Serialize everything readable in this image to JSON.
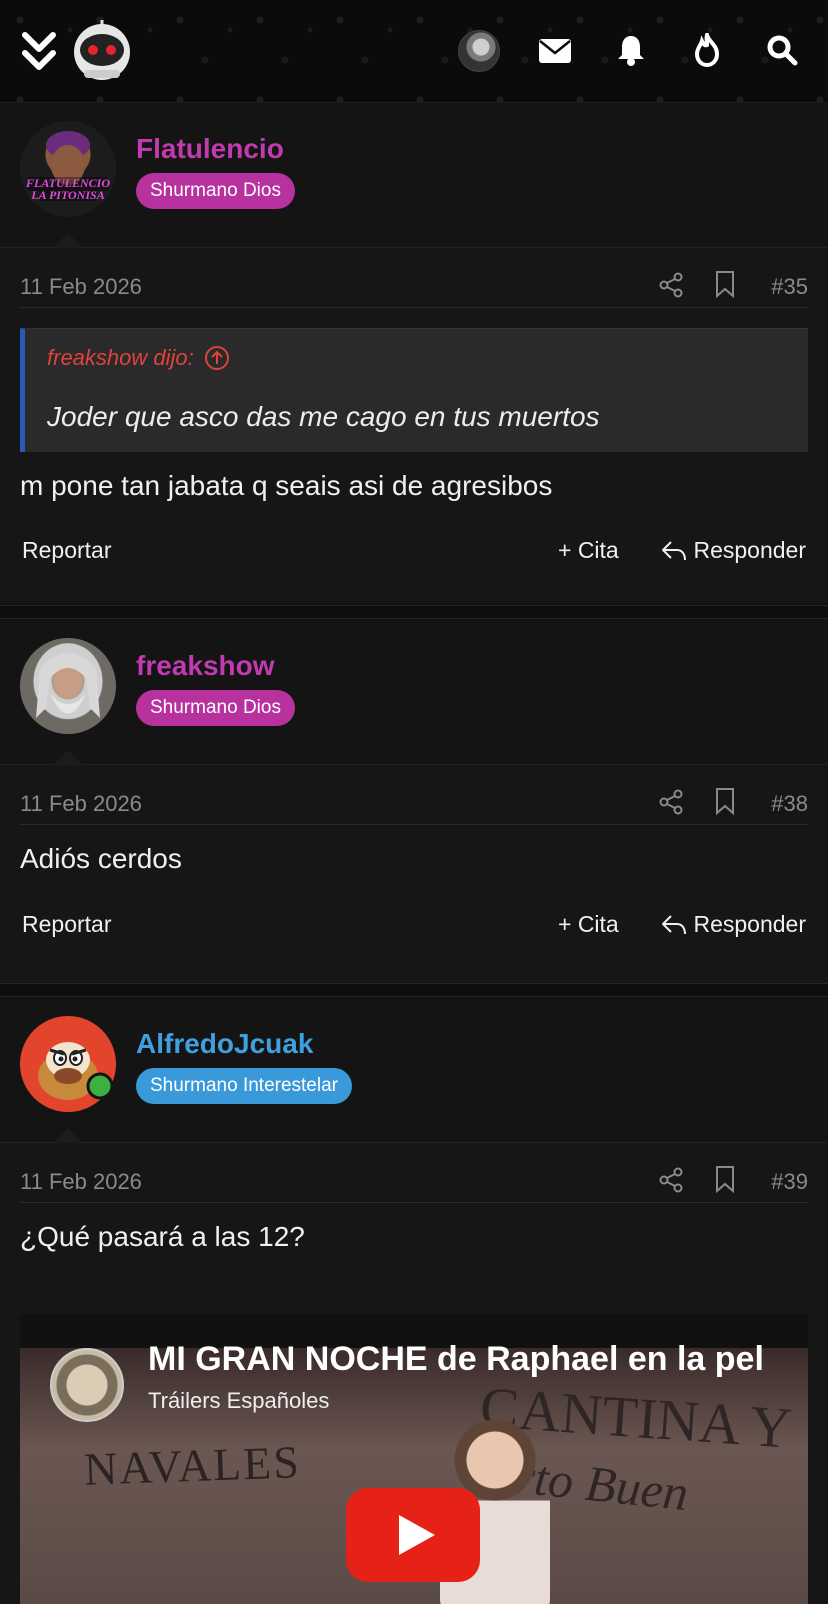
{
  "header": {
    "icons": [
      "chevrons-down-icon",
      "robot-logo",
      "user-avatar",
      "mail-icon",
      "bell-icon",
      "fire-icon",
      "search-icon"
    ]
  },
  "posts": [
    {
      "username": "Flatulencio",
      "rank": "Shurmano Dios",
      "avatar_caption": "FLATULENCIO\nLA PITONISA",
      "date": "11 Feb 2026",
      "number": "#35",
      "quote": {
        "author": "freakshow dijo:",
        "text": "Joder que asco das me cago en tus muertos"
      },
      "message": "m pone tan jabata q seais asi de agresibos",
      "actions": {
        "report": "Reportar",
        "quote": "+ Cita",
        "reply": "Responder"
      }
    },
    {
      "username": "freakshow",
      "rank": "Shurmano Dios",
      "date": "11 Feb 2026",
      "number": "#38",
      "message": "Adiós cerdos",
      "actions": {
        "report": "Reportar",
        "quote": "+ Cita",
        "reply": "Responder"
      }
    },
    {
      "username": "AlfredoJcuak",
      "rank": "Shurmano Interestelar",
      "online": true,
      "date": "11 Feb 2026",
      "number": "#39",
      "message": "¿Qué pasará a las 12?",
      "video": {
        "title": "MI GRAN NOCHE de Raphael en la pel",
        "channel": "Tráilers Españoles",
        "sign1": "NAVALES",
        "sign2": "CANTINA Y",
        "sign3": "urto Buen"
      }
    }
  ],
  "colors": {
    "rank_dios": "#b8329f",
    "rank_interestelar": "#3a9ad9",
    "username_dios": "#c23ab0",
    "username_interestelar": "#3fa0df",
    "quote_author": "#e0433c",
    "quote_border": "#2a58b8",
    "online": "#3cb043"
  }
}
